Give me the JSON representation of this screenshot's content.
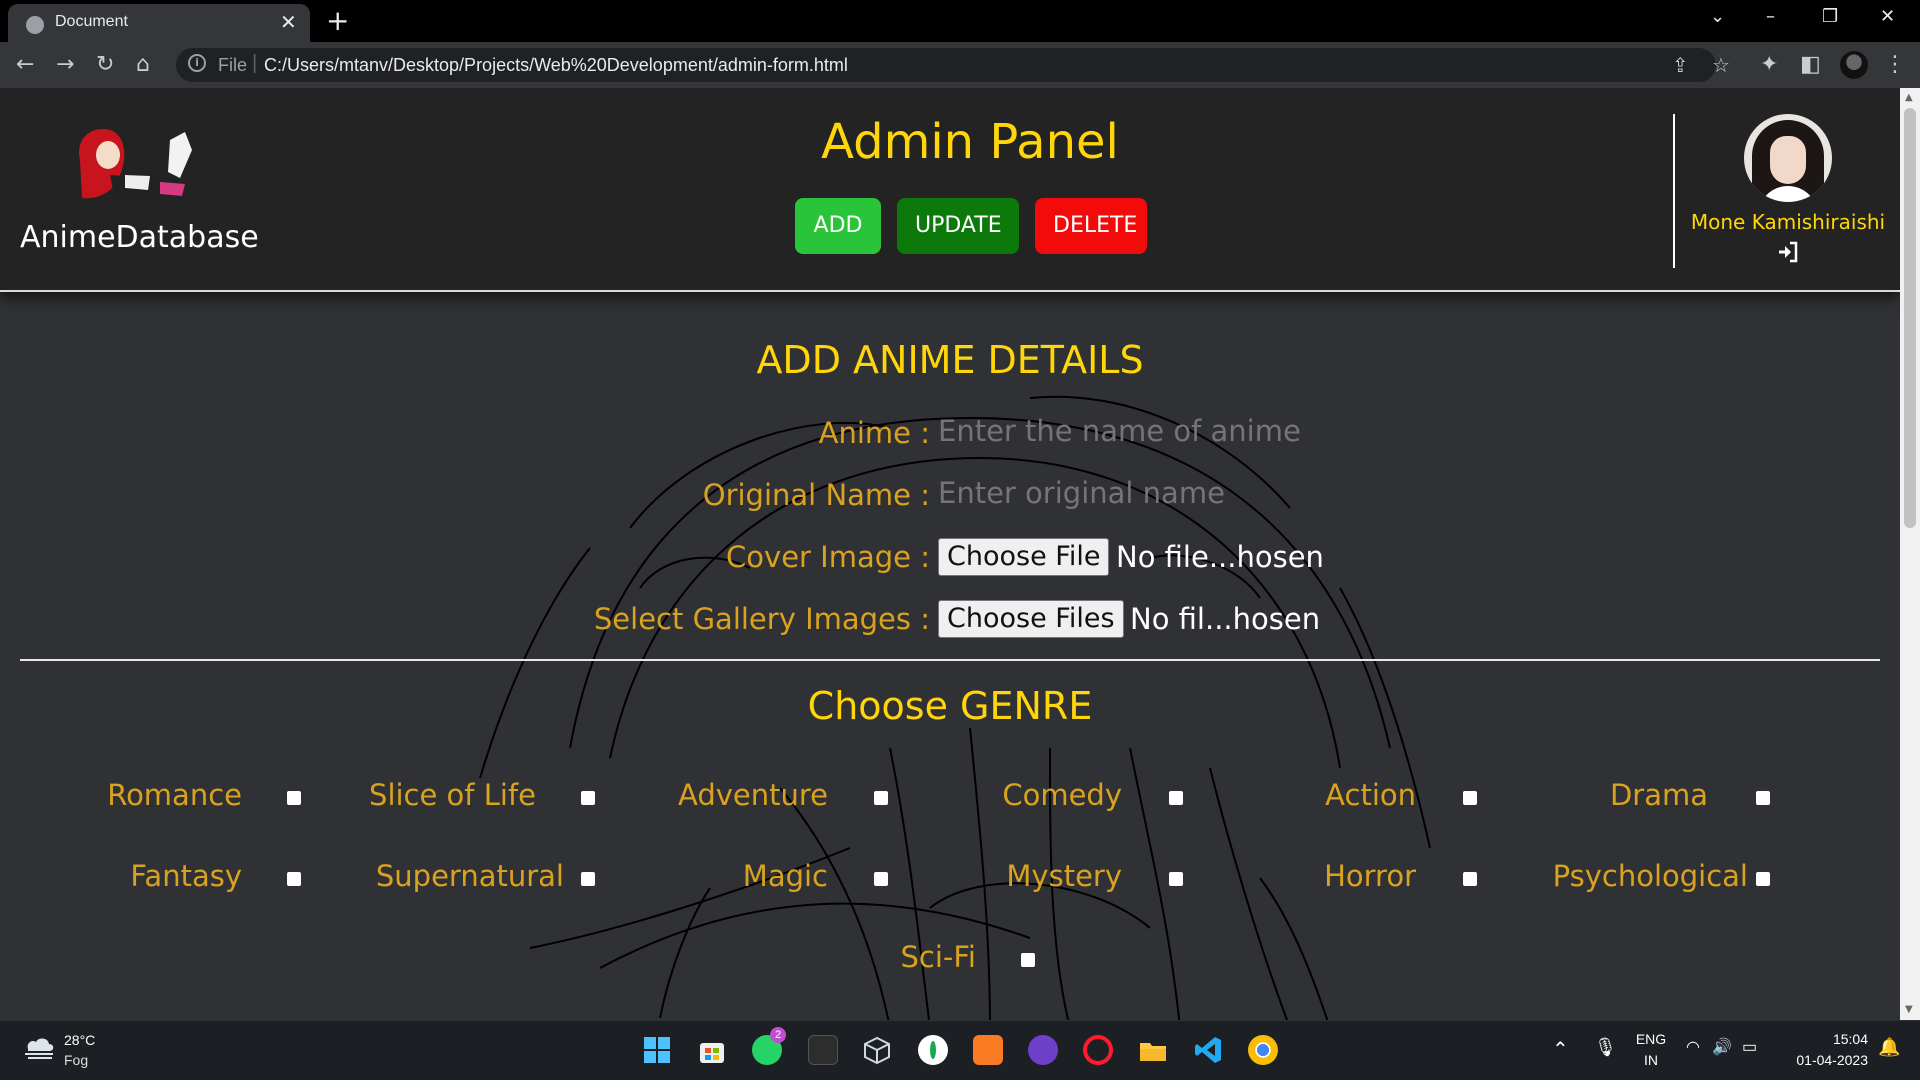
{
  "browser": {
    "tab_title": "Document",
    "url_scheme": "File",
    "url": "C:/Users/mtanv/Desktop/Projects/Web%20Development/admin-form.html"
  },
  "header": {
    "brand": "AnimeDatabase",
    "title": "Admin Panel",
    "buttons": {
      "add": "ADD",
      "update": "UPDATE",
      "delete": "DELETE"
    },
    "user_name": "Mone Kamishiraishi"
  },
  "form": {
    "title": "ADD ANIME DETAILS",
    "anime_label": "Anime :",
    "anime_placeholder": "Enter the name of anime",
    "original_label": "Original Name :",
    "original_placeholder": "Enter original name",
    "cover_label": "Cover Image :",
    "cover_button": "Choose File",
    "cover_status": "No file...hosen",
    "gallery_label": "Select Gallery Images :",
    "gallery_button": "Choose Files",
    "gallery_status": "No fil...hosen"
  },
  "genre": {
    "title": "Choose GENRE",
    "items": [
      "Romance",
      "Slice of Life",
      "Adventure",
      "Comedy",
      "Action",
      "Drama",
      "Fantasy",
      "Supernatural",
      "Magic",
      "Mystery",
      "Horror",
      "Psychological",
      "Sci-Fi"
    ]
  },
  "taskbar": {
    "temp": "28°C",
    "weather": "Fog",
    "whatsapp_badge": "2",
    "lang_top": "ENG",
    "lang_bottom": "IN",
    "time": "15:04",
    "date": "01-04-2023"
  },
  "colors": {
    "accent_yellow": "#ffd60a",
    "label_gold": "#d9a21f",
    "add_green": "#2ac43a",
    "update_green": "#0b7a0b",
    "delete_red": "#f30a0a"
  }
}
